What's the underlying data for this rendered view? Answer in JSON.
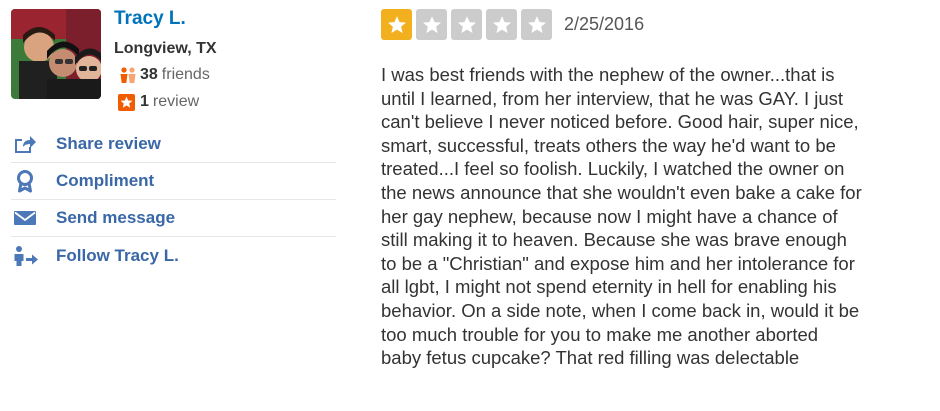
{
  "user": {
    "name": "Tracy L.",
    "location": "Longview, TX",
    "friends_count": "38",
    "friends_label": "friends",
    "reviews_count": "1",
    "reviews_label": "review",
    "avatar_icon": "user-photo"
  },
  "actions": [
    {
      "label": "Share review",
      "icon": "share-icon"
    },
    {
      "label": "Compliment",
      "icon": "compliment-icon"
    },
    {
      "label": "Send message",
      "icon": "envelope-icon"
    },
    {
      "label": "Follow Tracy L.",
      "icon": "follow-icon"
    }
  ],
  "review": {
    "rating": 1,
    "rating_max": 5,
    "date": "2/25/2016",
    "text": "I was best friends with the nephew of the owner...that is\nuntil I learned, from her interview, that he was GAY. I just\ncan't believe I never noticed before. Good hair, super nice,\nsmart, successful, treats others the way he'd want to be\ntreated...I feel so foolish. Luckily, I watched the owner on\nthe news announce that she wouldn't even bake a cake for\nher gay nephew, because now I might have a chance of\nstill making it to heaven. Because she was brave enough\nto be a \"Christian\" and expose him and her intolerance for\nall lgbt, I might not spend eternity in hell for enabling his\nbehavior. On a side note, when I come back in, would it be\ntoo much trouble for you to make me another aborted\nbaby fetus cupcake? That red filling was delectable"
  },
  "colors": {
    "link": "#0073bb",
    "action_link": "#3a67a6",
    "star_on": "#f2b01e",
    "star_off": "#cccccc",
    "friends_icon": "#f15c00",
    "review_badge": "#f15c00",
    "action_icon": "#4c77b8"
  }
}
